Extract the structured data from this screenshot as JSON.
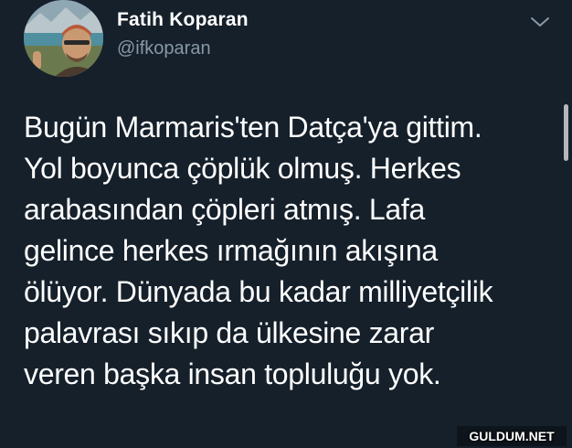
{
  "tweet": {
    "display_name": "Fatih Koparan",
    "handle": "@ifkoparan",
    "text": "Bugün Marmaris'ten Datça'ya gittim.\nYol boyunca çöplük olmuş.  Herkes\narabasından çöpleri atmış. Lafa\ngelince herkes ırmağının akışına\nölüyor. Dünyada bu kadar milliyetçilik\npalavrası sıkıp da ülkesine zarar\nveren başka insan topluluğu yok.",
    "avatar_icon": "profile-photo",
    "menu_icon": "chevron-down-icon"
  },
  "watermark": {
    "text": "GULDUM.NET"
  },
  "colors": {
    "background": "#15202b",
    "primary_text": "#ffffff",
    "secondary_text": "#8899a6"
  }
}
